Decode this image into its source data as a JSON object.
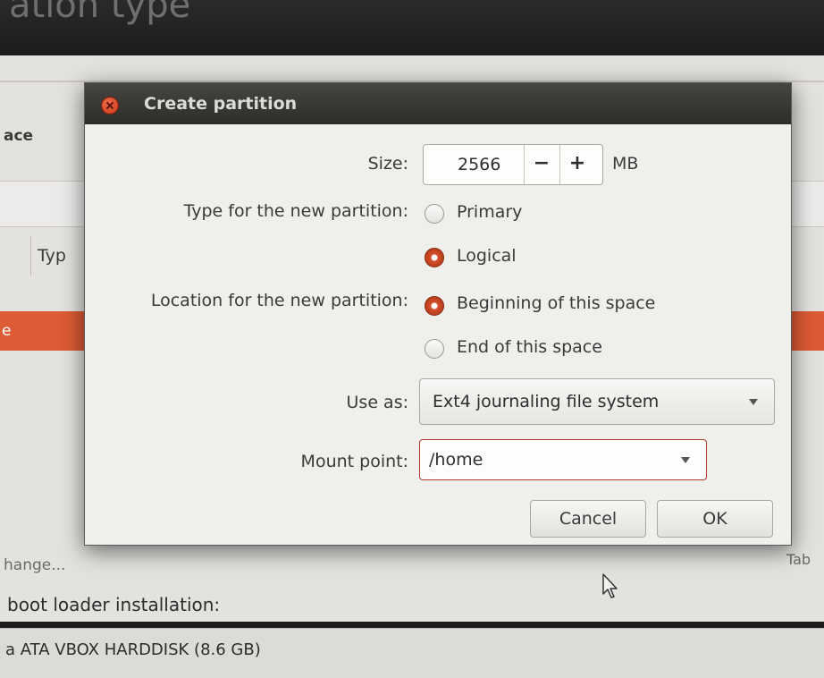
{
  "background": {
    "title_fragment": "ation type",
    "space_label": "ace",
    "column_type": "Typ",
    "selected_row_fragment": "e",
    "change_label": "hange...",
    "tab_fragment": "Tab",
    "boot_loader_text": "boot loader installation:",
    "disk_text": "a   ATA VBOX HARDDISK (8.6 GB)"
  },
  "dialog": {
    "title": "Create partition",
    "size_label": "Size:",
    "size_value": "2566",
    "size_decrement": "−",
    "size_increment": "+",
    "size_unit": "MB",
    "type_label": "Type for the new partition:",
    "type_options": [
      "Primary",
      "Logical"
    ],
    "type_selected": "Logical",
    "location_label": "Location for the new partition:",
    "location_options": [
      "Beginning of this space",
      "End of this space"
    ],
    "location_selected": "Beginning of this space",
    "use_as_label": "Use as:",
    "use_as_value": "Ext4 journaling file system",
    "mount_label": "Mount point:",
    "mount_value": "/home",
    "cancel_label": "Cancel",
    "ok_label": "OK"
  },
  "icons": [
    "close-icon",
    "chevron-down-icon",
    "mouse-cursor-icon"
  ],
  "colors": {
    "accent": "#de5b35",
    "titlebar": "#3a3937",
    "dialog_bg": "#efefec"
  }
}
